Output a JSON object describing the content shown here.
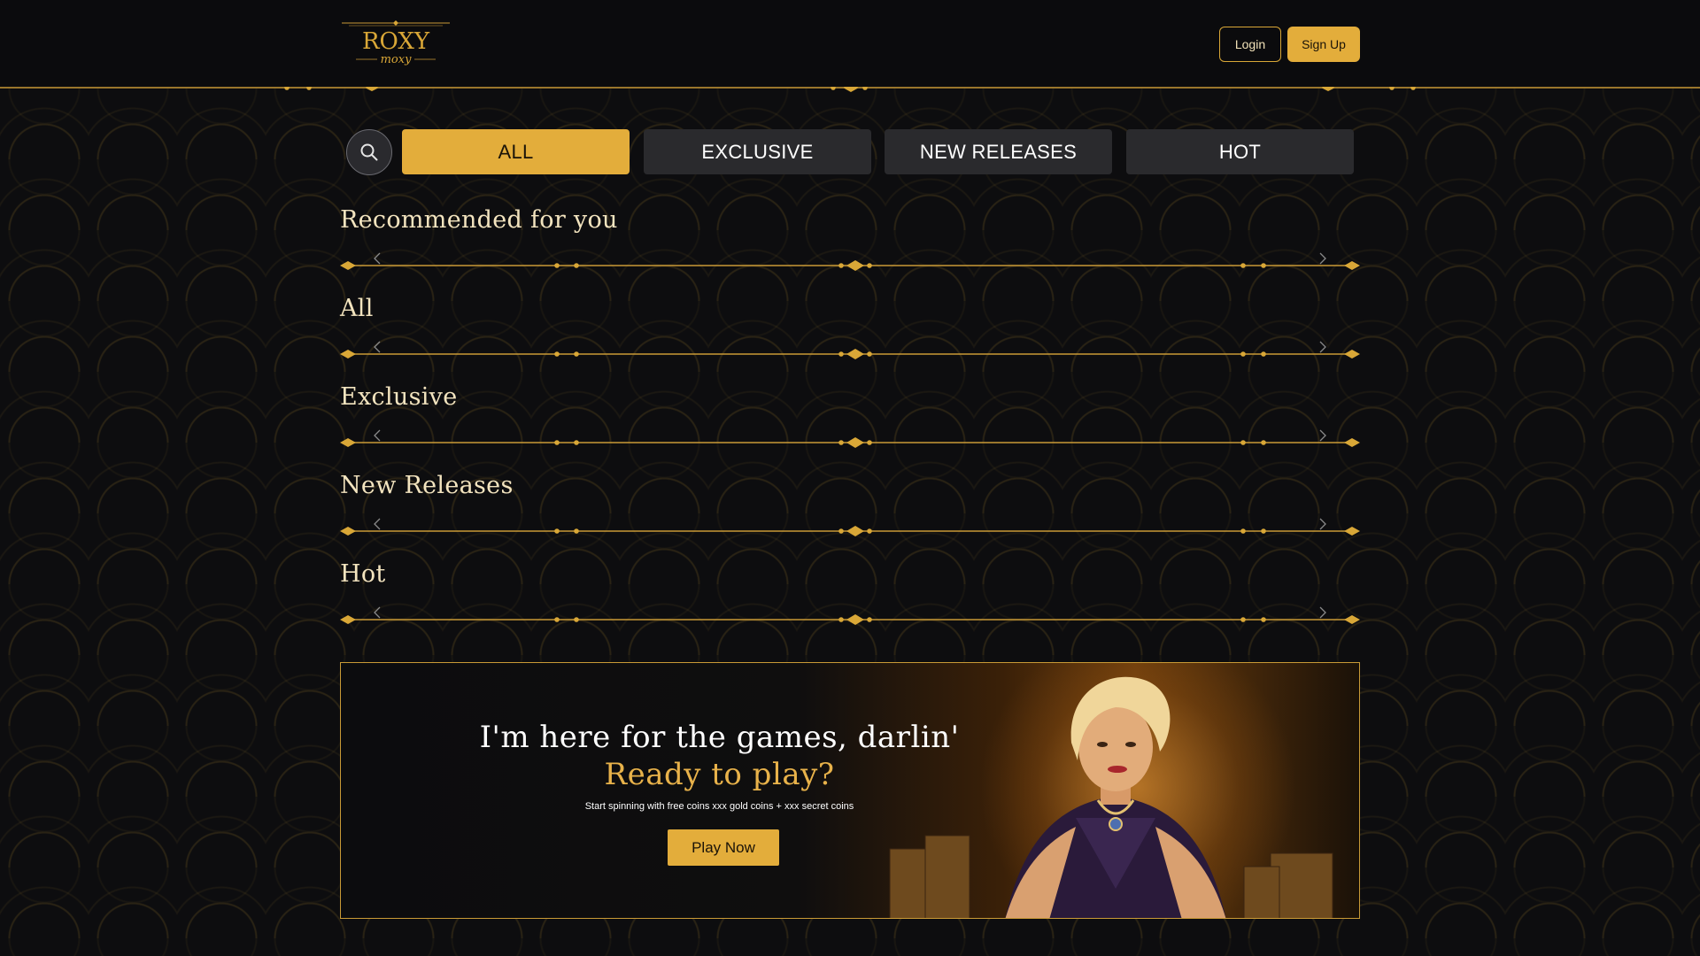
{
  "header": {
    "logo_main": "ROXY",
    "logo_sub": "moxy",
    "login_label": "Login",
    "signup_label": "Sign Up"
  },
  "filters": {
    "tabs": [
      {
        "label": "ALL",
        "active": true
      },
      {
        "label": "EXCLUSIVE",
        "active": false
      },
      {
        "label": "NEW RELEASES",
        "active": false
      },
      {
        "label": "HOT",
        "active": false
      }
    ]
  },
  "sections": [
    {
      "title": "Recommended for you"
    },
    {
      "title": "All"
    },
    {
      "title": "Exclusive"
    },
    {
      "title": "New Releases"
    },
    {
      "title": "Hot"
    }
  ],
  "banner": {
    "headline": "I'm here for the games, darlin'",
    "subheadline": "Ready to play?",
    "note": "Start spinning with free coins xxx gold coins + xxx secret coins",
    "cta_label": "Play Now"
  },
  "colors": {
    "gold": "#e3ad3b",
    "background": "#0b0b0d",
    "tab_inactive": "#2a2a2d"
  },
  "icons": {
    "search": "search-icon",
    "prev": "chevron-left-icon",
    "next": "chevron-right-icon"
  }
}
